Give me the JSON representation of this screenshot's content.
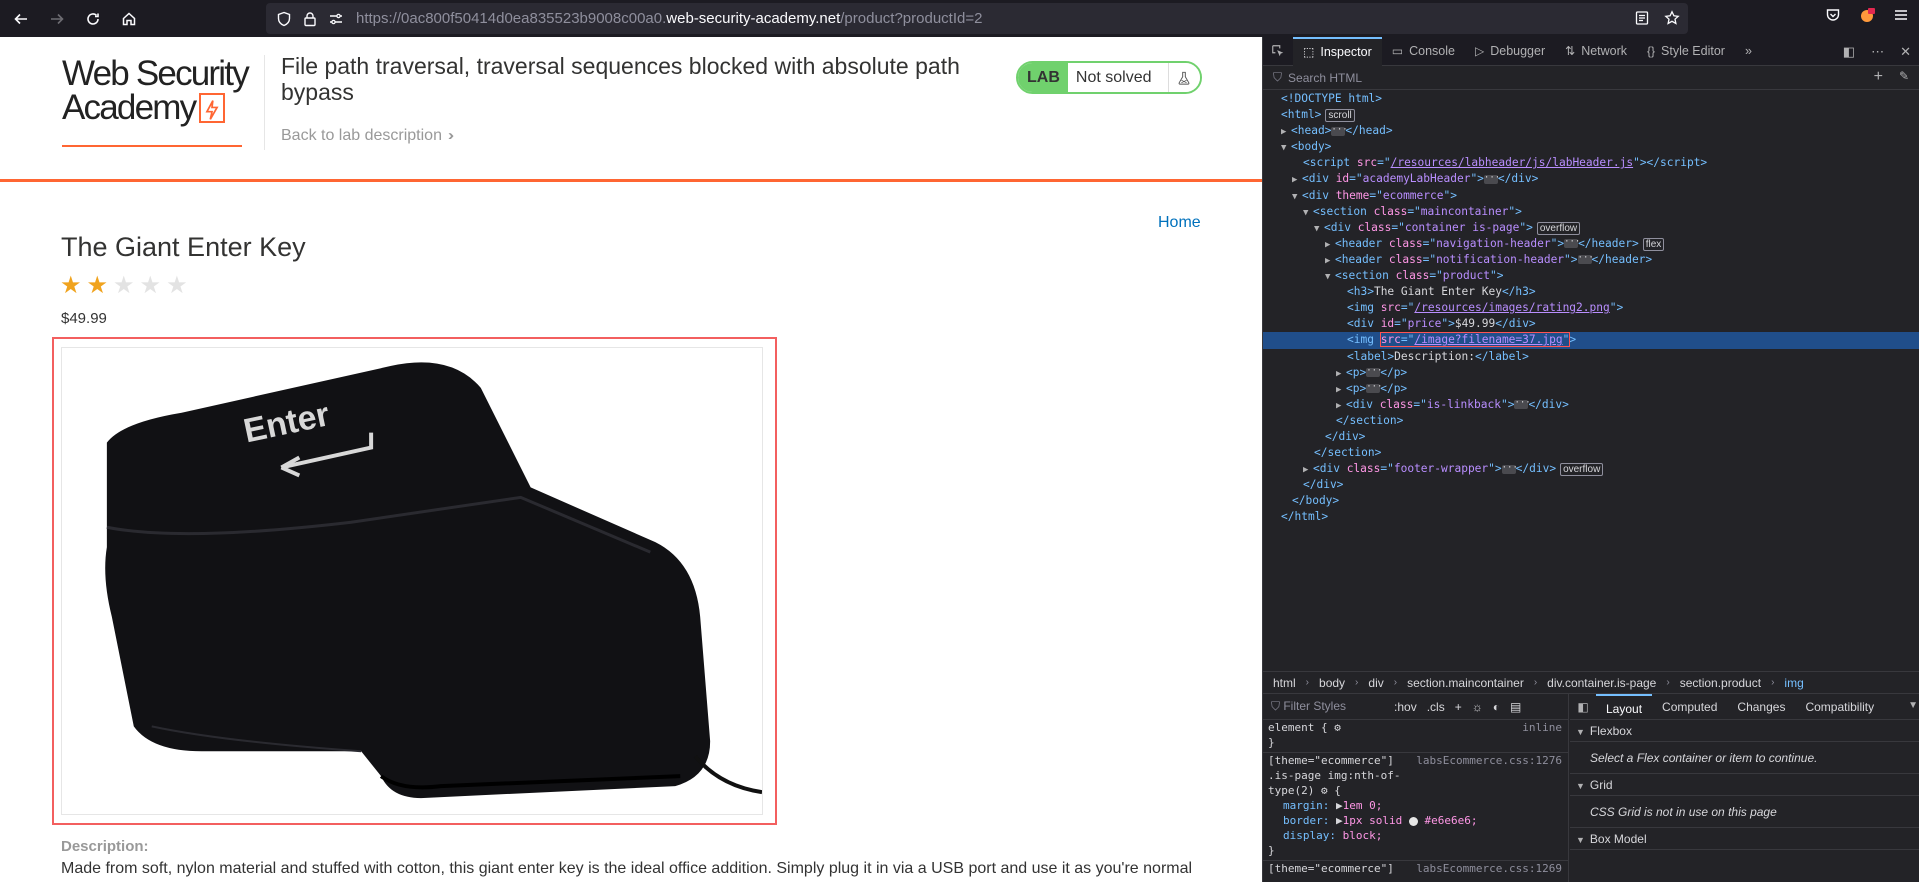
{
  "browser": {
    "url_prefix": "https://0ac800f50414d0ea835523b9008c00a0.",
    "url_host": "web-security-academy.net",
    "url_path": "/product?productId=2"
  },
  "lab": {
    "logo_line1": "Web Security",
    "logo_line2": "Academy",
    "title": "File path traversal, traversal sequences blocked with absolute path bypass",
    "back_link": "Back to lab description",
    "badge": "LAB",
    "status": "Not solved"
  },
  "shop": {
    "home": "Home",
    "product_title": "The Giant Enter Key",
    "rating": 2,
    "rating_max": 5,
    "price": "$49.99",
    "image_text": "Enter",
    "description_label": "Description:",
    "description": "Made from soft, nylon material and stuffed with cotton, this giant enter key is the ideal office addition. Simply plug it in via a USB port and use it as you're normal"
  },
  "devtools": {
    "tabs": [
      "Inspector",
      "Console",
      "Debugger",
      "Network",
      "Style Editor"
    ],
    "search_placeholder": "Search HTML",
    "breadcrumbs": [
      "html",
      "body",
      "div",
      "section.maincontainer",
      "div.container.is-page",
      "section.product",
      "img"
    ],
    "styles_filter": "Filter Styles",
    "hov": ":hov",
    "cls": ".cls",
    "layout_tabs": [
      "Layout",
      "Computed",
      "Changes",
      "Compatibility"
    ],
    "flexbox_title": "Flexbox",
    "flexbox_note": "Select a Flex container or item to continue.",
    "grid_title": "Grid",
    "grid_note": "CSS Grid is not in use on this page",
    "boxmodel_title": "Box Model",
    "rule1_selector": "element {",
    "rule1_source": "inline",
    "rule2_selector_a": "[theme=\"ecommerce\"]",
    "rule2_selector_b": ".is-page img:nth-of-",
    "rule2_selector_c": "type(2)",
    "rule2_source": "labsEcommerce.css:1276",
    "rule3_source": "labsEcommerce.css:1269",
    "prop_margin": "margin:",
    "val_margin": "1em 0;",
    "prop_border": "border:",
    "val_border": "1px solid",
    "val_border_color": "#e6e6e6;",
    "prop_display": "display:",
    "val_display": "block;"
  },
  "colors": {
    "accent_orange": "#ff6633",
    "lab_green": "#70d16d",
    "star_gold": "#f0a31e",
    "selection_blue": "#204e8a",
    "highlight_red": "#f35f5f"
  }
}
